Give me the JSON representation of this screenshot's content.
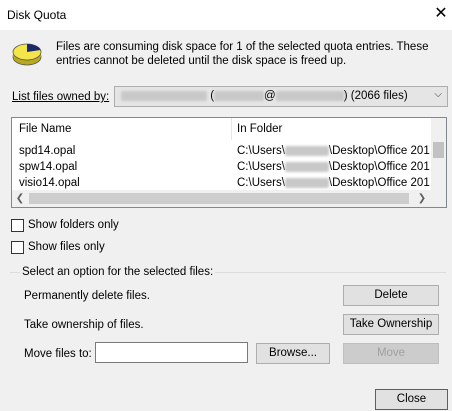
{
  "window": {
    "title": "Disk Quota",
    "close_glyph": "✕"
  },
  "message": "Files are consuming disk space for 1 of the selected quota entries.  These entries cannot be deleted until the disk space is freed up.",
  "owner": {
    "label": "List files owned by:",
    "at": "@",
    "count": ") (2066 files)",
    "paren_open": "("
  },
  "list": {
    "columns": [
      "File Name",
      "In Folder"
    ],
    "rows": [
      {
        "name": "spd14.opal",
        "folder_prefix": "C:\\Users\\",
        "folder_suffix": "\\Desktop\\Office 201"
      },
      {
        "name": "spw14.opal",
        "folder_prefix": "C:\\Users\\",
        "folder_suffix": "\\Desktop\\Office 201"
      },
      {
        "name": "visio14.opal",
        "folder_prefix": "C:\\Users\\",
        "folder_suffix": "\\Desktop\\Office 201"
      }
    ]
  },
  "options": {
    "show_folders": "Show folders only",
    "show_files": "Show files only"
  },
  "actions": {
    "group_title": "Select an option for the selected files:",
    "delete_label": "Permanently delete files.",
    "delete_button": "Delete",
    "ownership_label": "Take ownership of files.",
    "ownership_button": "Take Ownership",
    "move_label": "Move files to:",
    "move_value": "",
    "browse_button": "Browse...",
    "move_button": "Move"
  },
  "footer": {
    "close_button": "Close"
  },
  "colors": {
    "pie_yellow": "#f4e64a",
    "pie_dark": "#1c2a6b",
    "accent": "#0078d7"
  }
}
